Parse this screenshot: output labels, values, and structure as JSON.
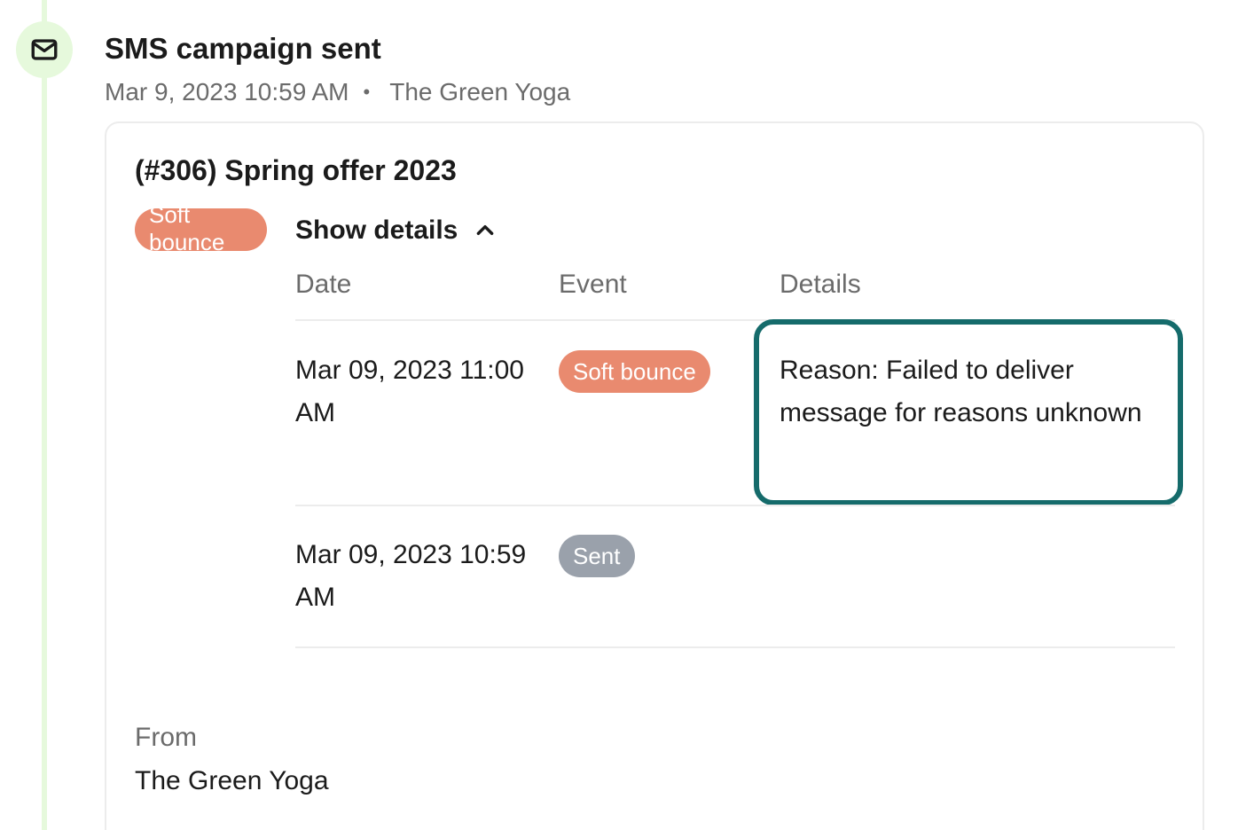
{
  "event": {
    "icon": "mail-icon",
    "title": "SMS campaign sent",
    "date": "Mar 9, 2023 10:59 AM",
    "separator": "•",
    "source": "The Green Yoga"
  },
  "campaign": {
    "title": "(#306) Spring offer 2023",
    "status": "Soft bounce",
    "status_color": "#e98a6f",
    "toggle_label": "Show details",
    "toggle_icon": "chevron-up-icon"
  },
  "table": {
    "headers": {
      "date": "Date",
      "event": "Event",
      "details": "Details"
    },
    "rows": [
      {
        "date": "Mar 09, 2023 11:00 AM",
        "event": "Soft bounce",
        "event_color": "#e98a6f",
        "details": "Reason: Failed to deliver message for reasons unknown"
      },
      {
        "date": "Mar 09, 2023 10:59 AM",
        "event": "Sent",
        "event_color": "#9aa1ab",
        "details": ""
      }
    ]
  },
  "from": {
    "label": "From",
    "value": "The Green Yoga"
  },
  "colors": {
    "timeline": "#e6f9dc",
    "highlight_border": "#156b6b"
  }
}
